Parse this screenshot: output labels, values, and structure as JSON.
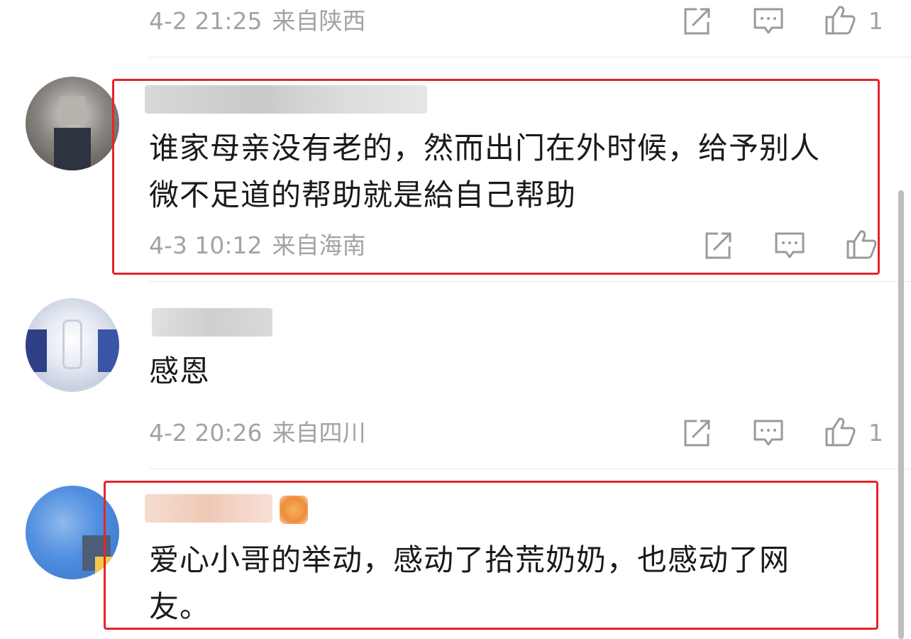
{
  "comments": [
    {
      "timestamp": "4-2 21:25",
      "location": "来自陕西",
      "likes": "1"
    },
    {
      "username": "",
      "text_line1": "谁家母亲没有老的，然而出门在外时候，给予别人",
      "text_line2": "微不足道的帮助就是給自己帮助",
      "timestamp": "4-3 10:12",
      "location": "来自海南",
      "likes": ""
    },
    {
      "username": "",
      "text_line1": "感恩",
      "timestamp": "4-2 20:26",
      "location": "来自四川",
      "likes": "1"
    },
    {
      "username": "",
      "text_line1": "爱心小哥的举动，感动了拾荒奶奶，也感动了网",
      "text_line2": "友。"
    }
  ],
  "icons": {
    "repost": "repost-icon",
    "comment": "comment-icon",
    "like": "thumbs-up-icon"
  },
  "colors": {
    "highlight": "#e5252a",
    "meta_text": "#a3a3a3",
    "body_text": "#1a1a1a"
  }
}
